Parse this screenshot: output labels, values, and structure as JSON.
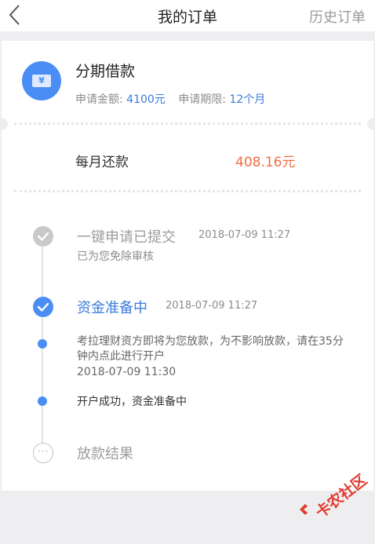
{
  "nav": {
    "title": "我的订单",
    "history_label": "历史订单"
  },
  "loan": {
    "icon_symbol": "¥",
    "title": "分期借款",
    "amount_label": "申请金额:",
    "amount_value": "4100元",
    "term_label": "申请期限:",
    "term_value": "12个月"
  },
  "repayment": {
    "label": "每月还款",
    "value": "408.16元"
  },
  "timeline": {
    "step1": {
      "title": "一键申请已提交",
      "time": "2018-07-09 11:27",
      "sub": "已为您免除审核"
    },
    "step2": {
      "title": "资金准备中",
      "time": "2018-07-09 11:27"
    },
    "step2a": {
      "desc": "考拉理财资方即将为您放款，为不影响放款，请在35分钟内点此进行开户",
      "time": "2018-07-09 11:30"
    },
    "step2b": {
      "text": "开户成功，资金准备中"
    },
    "step3": {
      "title": "放款结果",
      "icon_text": "···"
    }
  },
  "watermark": {
    "text": "卡农社区"
  },
  "colors": {
    "accent_blue": "#4a8ef5",
    "amount_blue": "#3b7cdc",
    "monthly_orange": "#ee6d43",
    "watermark_red": "#e23a2e"
  }
}
